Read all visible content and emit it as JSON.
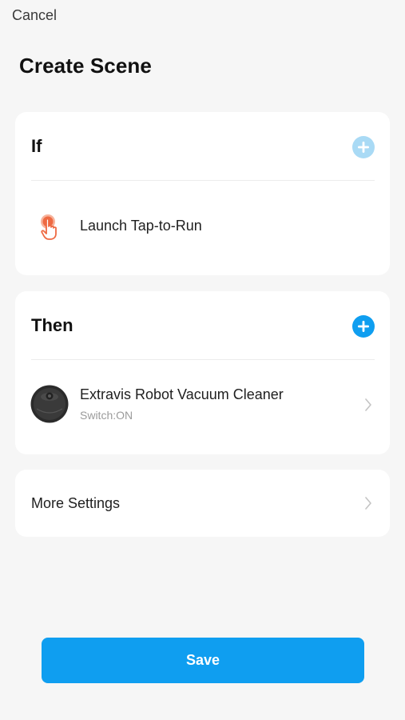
{
  "header": {
    "cancel_label": "Cancel",
    "title": "Create Scene"
  },
  "if_section": {
    "title": "If",
    "add_icon": "plus-icon",
    "add_color": "#a9daf5",
    "condition": {
      "icon": "tap-hand-icon",
      "label": "Launch Tap-to-Run"
    }
  },
  "then_section": {
    "title": "Then",
    "add_icon": "plus-icon",
    "add_color": "#0f9ef0",
    "action": {
      "icon": "robot-vacuum-icon",
      "name": "Extravis Robot Vacuum Cleaner",
      "status": "Switch:ON"
    }
  },
  "more_settings": {
    "label": "More Settings"
  },
  "footer": {
    "save_label": "Save",
    "save_color": "#0f9ef0"
  }
}
